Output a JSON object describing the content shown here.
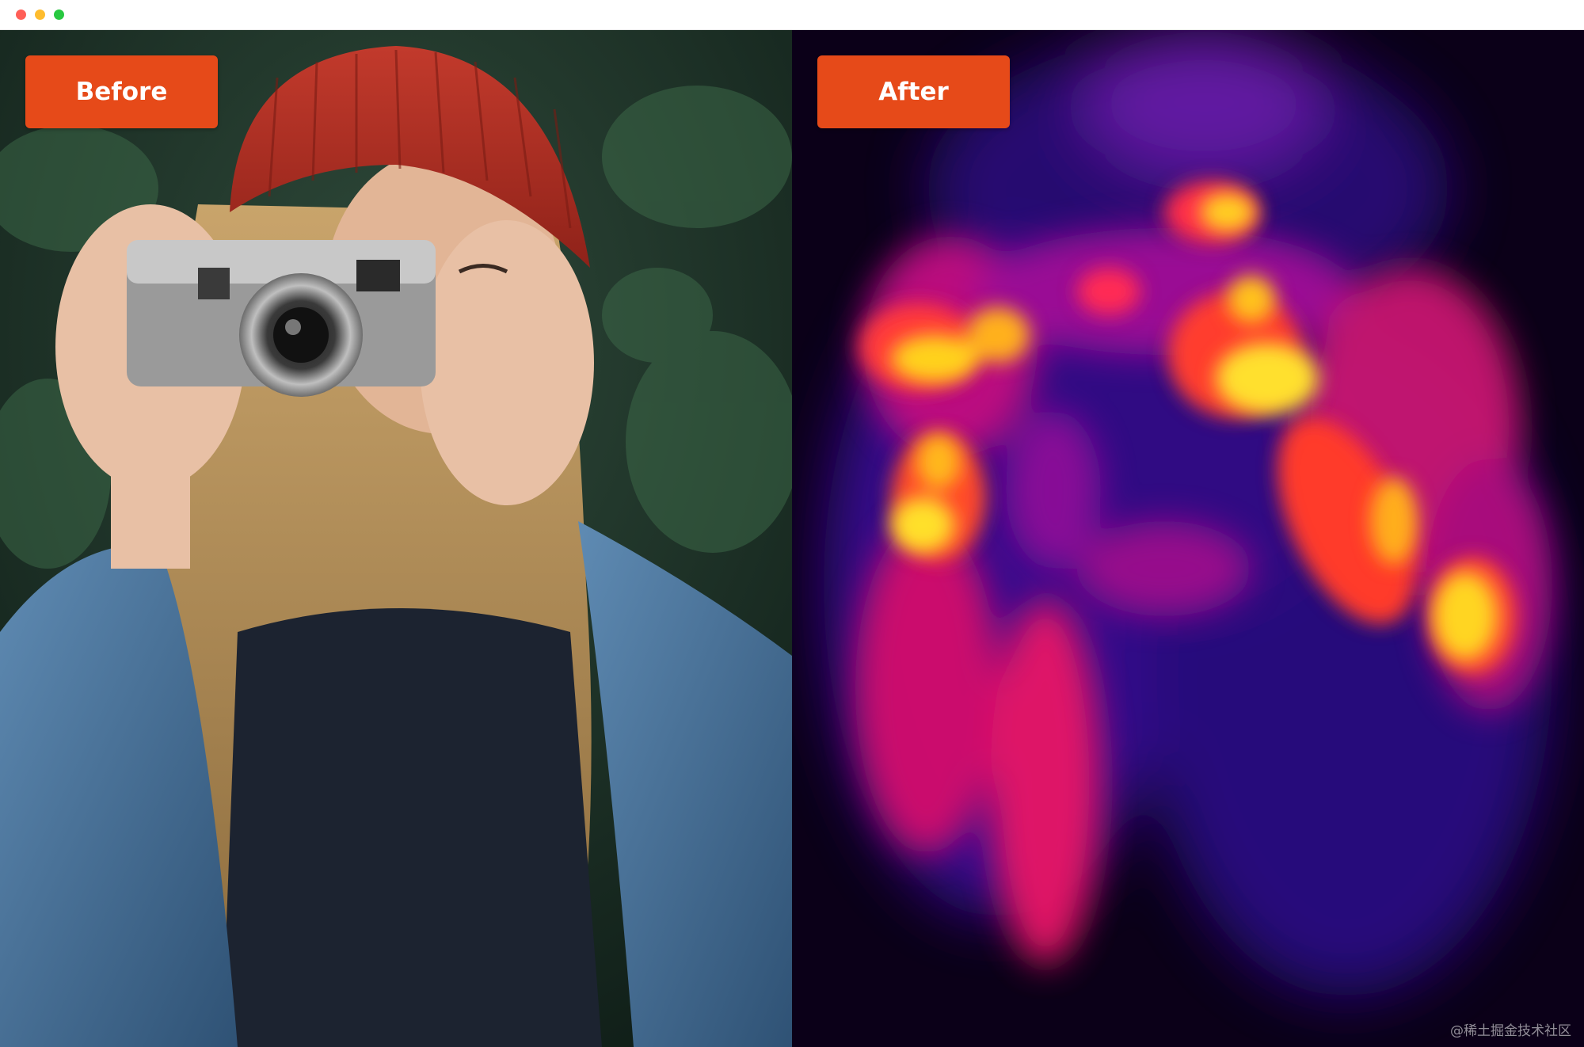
{
  "window": {
    "controls": [
      "close",
      "minimize",
      "maximize"
    ],
    "colors": {
      "close": "#ff5f57",
      "minimize": "#febc2e",
      "maximize": "#28c840"
    }
  },
  "panels": {
    "before": {
      "label": "Before",
      "image_description_icon": "photo-woman-camera"
    },
    "after": {
      "label": "After",
      "image_description_icon": "saliency-heatmap"
    }
  },
  "accent_color": "#e64a19",
  "watermark": "@稀土掘金技术社区"
}
